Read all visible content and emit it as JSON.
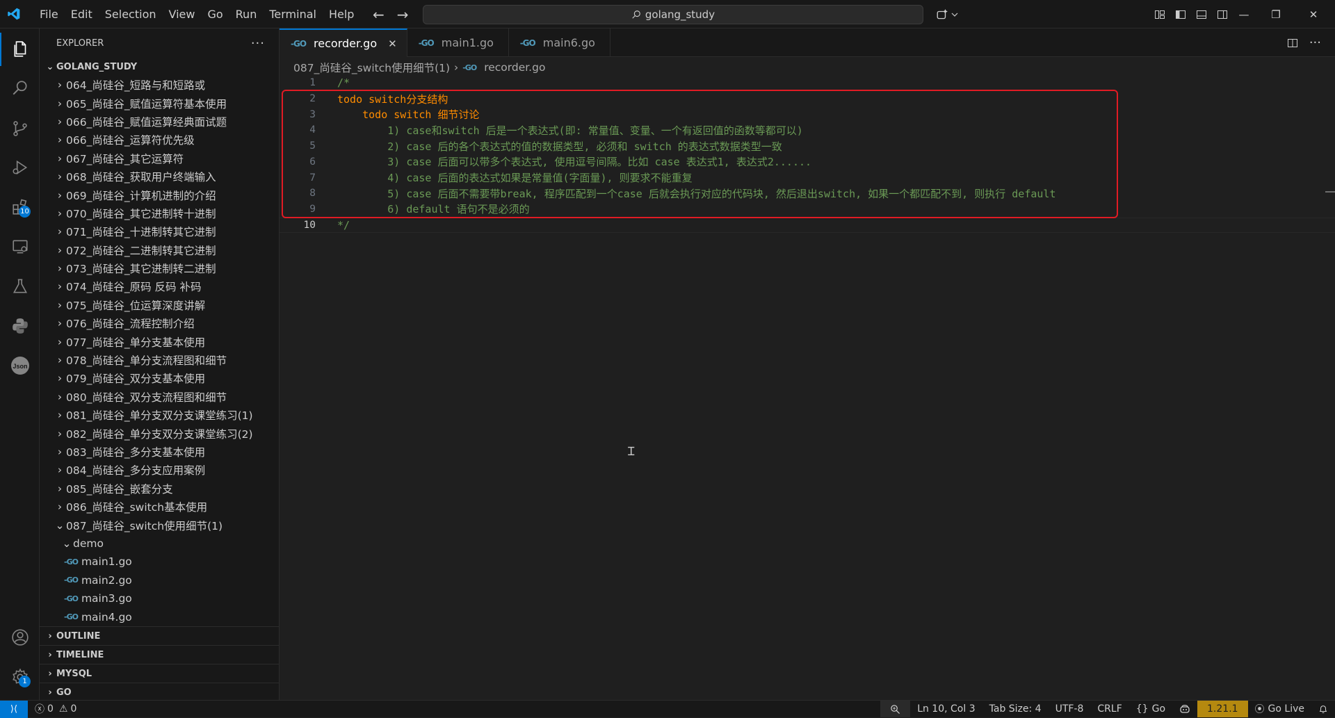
{
  "titlebar": {
    "menu": [
      "File",
      "Edit",
      "Selection",
      "View",
      "Go",
      "Run",
      "Terminal",
      "Help"
    ],
    "search_text": "golang_study"
  },
  "activity": {
    "extensions_badge": "10",
    "settings_badge": "1"
  },
  "sidebar": {
    "title": "EXPLORER",
    "more": "···",
    "root": "GOLANG_STUDY",
    "folders": [
      "064_尚硅谷_短路与和短路或",
      "065_尚硅谷_赋值运算符基本使用",
      "066_尚硅谷_赋值运算经典面试题",
      "066_尚硅谷_运算符优先级",
      "067_尚硅谷_其它运算符",
      "068_尚硅谷_获取用户终端输入",
      "069_尚硅谷_计算机进制的介绍",
      "070_尚硅谷_其它进制转十进制",
      "071_尚硅谷_十进制转其它进制",
      "072_尚硅谷_二进制转其它进制",
      "073_尚硅谷_其它进制转二进制",
      "074_尚硅谷_原码 反码 补码",
      "075_尚硅谷_位运算深度讲解",
      "076_尚硅谷_流程控制介绍",
      "077_尚硅谷_单分支基本使用",
      "078_尚硅谷_单分支流程图和细节",
      "079_尚硅谷_双分支基本使用",
      "080_尚硅谷_双分支流程图和细节",
      "081_尚硅谷_单分支双分支课堂练习(1)",
      "082_尚硅谷_单分支双分支课堂练习(2)",
      "083_尚硅谷_多分支基本使用",
      "084_尚硅谷_多分支应用案例",
      "085_尚硅谷_嵌套分支",
      "086_尚硅谷_switch基本使用"
    ],
    "open_folder": "087_尚硅谷_switch使用细节(1)",
    "subfolder": "demo",
    "files": [
      "main1.go",
      "main2.go",
      "main3.go",
      "main4.go"
    ],
    "panels": [
      "OUTLINE",
      "TIMELINE",
      "MYSQL",
      "GO"
    ]
  },
  "editor": {
    "tabs": [
      "recorder.go",
      "main1.go",
      "main6.go"
    ],
    "breadcrumb": [
      "087_尚硅谷_switch使用细节(1)",
      "recorder.go"
    ],
    "lines": [
      {
        "n": "1",
        "text": "/*"
      },
      {
        "n": "2",
        "text": "todo switch分支结构"
      },
      {
        "n": "3",
        "text": "    todo switch 细节讨论"
      },
      {
        "n": "4",
        "text": "        1) case和switch 后是一个表达式(即: 常量值、变量、一个有返回值的函数等都可以)"
      },
      {
        "n": "5",
        "text": "        2) case 后的各个表达式的值的数据类型, 必须和 switch 的表达式数据类型一致"
      },
      {
        "n": "6",
        "text": "        3) case 后面可以带多个表达式, 使用逗号间隔。比如 case 表达式1, 表达式2......"
      },
      {
        "n": "7",
        "text": "        4) case 后面的表达式如果是常量值(字面量), 则要求不能重复"
      },
      {
        "n": "8",
        "text": "        5) case 后面不需要带break, 程序匹配到一个case 后就会执行对应的代码块, 然后退出switch, 如果一个都匹配不到, 则执行 default"
      },
      {
        "n": "9",
        "text": "        6) default 语句不是必须的"
      },
      {
        "n": "10",
        "text": "*/"
      }
    ]
  },
  "statusbar": {
    "errors": "0",
    "warnings": "0",
    "position": "Ln 10, Col 3",
    "tab_size": "Tab Size: 4",
    "encoding": "UTF-8",
    "eol": "CRLF",
    "language": "Go",
    "go_version": "1.21.1",
    "go_live": "Go Live"
  }
}
